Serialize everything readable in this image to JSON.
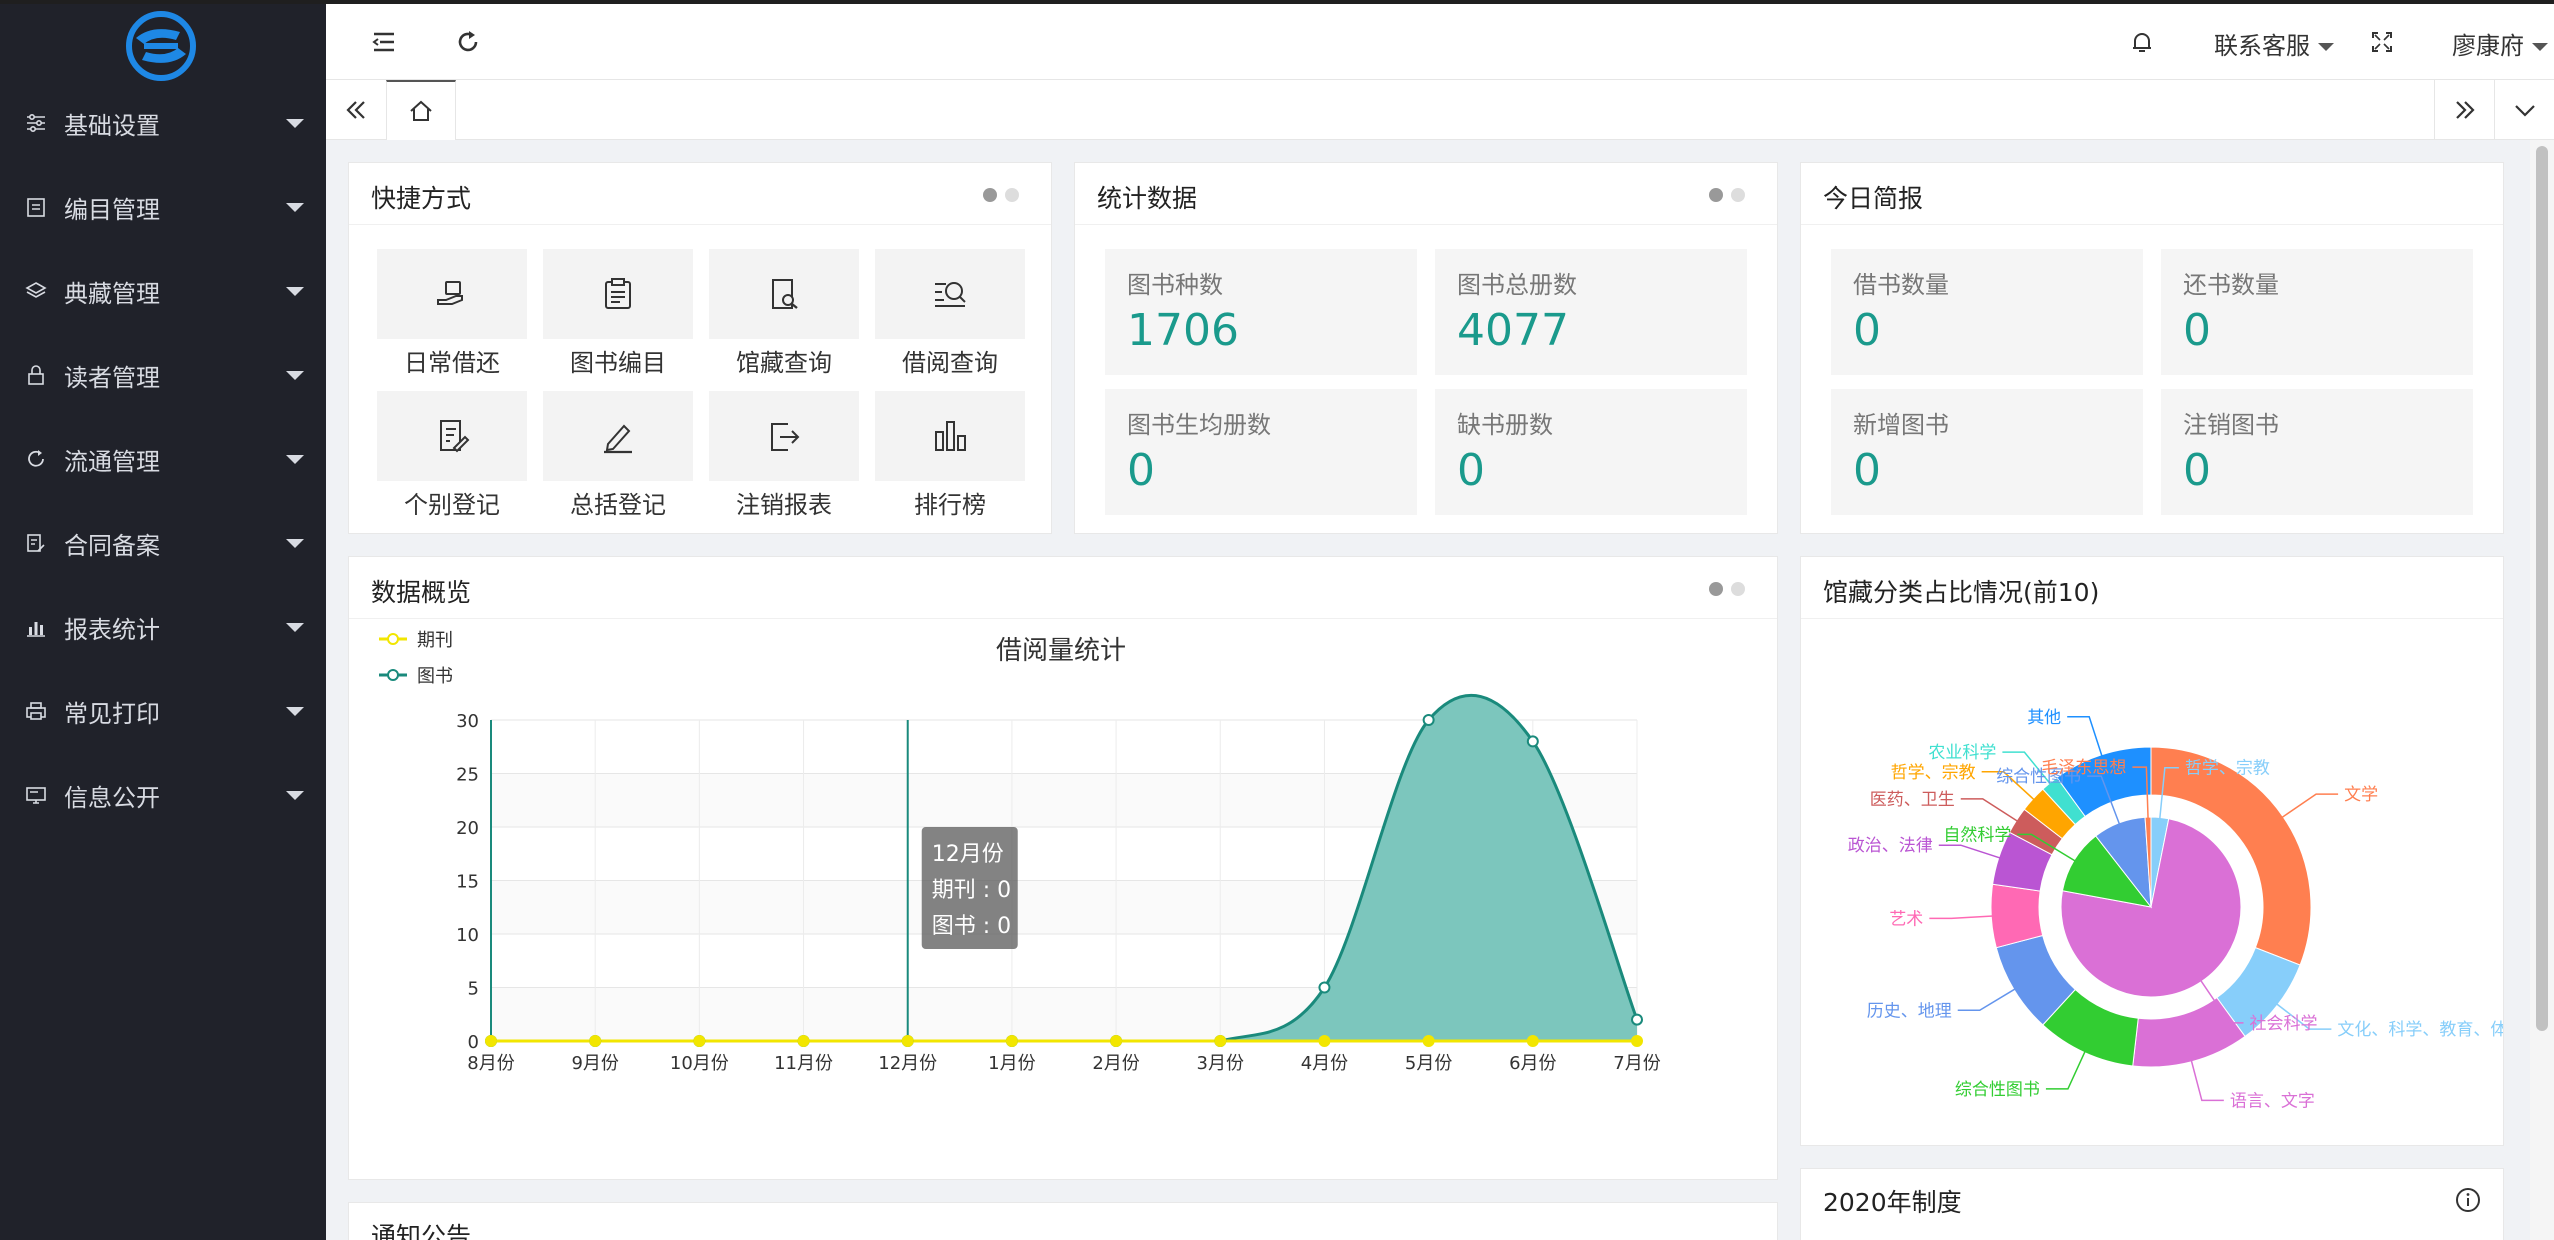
{
  "sidebar": {
    "items": [
      {
        "label": "基础设置",
        "icon": "sliders-icon"
      },
      {
        "label": "编目管理",
        "icon": "catalog-icon"
      },
      {
        "label": "典藏管理",
        "icon": "layers-icon"
      },
      {
        "label": "读者管理",
        "icon": "lock-icon"
      },
      {
        "label": "流通管理",
        "icon": "refresh-icon"
      },
      {
        "label": "合同备案",
        "icon": "contract-icon"
      },
      {
        "label": "报表统计",
        "icon": "bar-chart-icon"
      },
      {
        "label": "常见打印",
        "icon": "printer-icon"
      },
      {
        "label": "信息公开",
        "icon": "monitor-icon"
      }
    ]
  },
  "header": {
    "support_label": "联系客服",
    "user_name": "廖康府"
  },
  "quick": {
    "title": "快捷方式",
    "items": [
      {
        "label": "日常借还",
        "icon": "hand-book-icon"
      },
      {
        "label": "图书编目",
        "icon": "clipboard-icon"
      },
      {
        "label": "馆藏查询",
        "icon": "book-search-icon"
      },
      {
        "label": "借阅查询",
        "icon": "list-search-icon"
      },
      {
        "label": "个别登记",
        "icon": "doc-edit-icon"
      },
      {
        "label": "总括登记",
        "icon": "pen-icon"
      },
      {
        "label": "注销报表",
        "icon": "exit-icon"
      },
      {
        "label": "排行榜",
        "icon": "ranking-icon"
      }
    ]
  },
  "stats": {
    "title": "统计数据",
    "items": [
      {
        "label": "图书种数",
        "value": "1706"
      },
      {
        "label": "图书总册数",
        "value": "4077"
      },
      {
        "label": "图书生均册数",
        "value": "0"
      },
      {
        "label": "缺书册数",
        "value": "0"
      }
    ]
  },
  "today": {
    "title": "今日简报",
    "items": [
      {
        "label": "借书数量",
        "value": "0"
      },
      {
        "label": "还书数量",
        "value": "0"
      },
      {
        "label": "新增图书",
        "value": "0"
      },
      {
        "label": "注销图书",
        "value": "0"
      }
    ]
  },
  "overview": {
    "title": "数据概览"
  },
  "category": {
    "title": "馆藏分类占比情况(前10)"
  },
  "notice": {
    "title": "通知公告"
  },
  "policy": {
    "title": "2020年制度"
  },
  "tooltip": {
    "title": "12月份",
    "line1": "期刊 : 0",
    "line2": "图书 : 0"
  },
  "chart_data": [
    {
      "type": "area",
      "title": "借阅量统计",
      "categories": [
        "8月份",
        "9月份",
        "10月份",
        "11月份",
        "12月份",
        "1月份",
        "2月份",
        "3月份",
        "4月份",
        "5月份",
        "6月份",
        "7月份"
      ],
      "series": [
        {
          "name": "期刊",
          "values": [
            0,
            0,
            0,
            0,
            0,
            0,
            0,
            0,
            0,
            0,
            0,
            0
          ],
          "color": "#f2e600"
        },
        {
          "name": "图书",
          "values": [
            0,
            0,
            0,
            0,
            0,
            0,
            0,
            0,
            5,
            30,
            28,
            2
          ],
          "color": "#1a8a7c"
        }
      ],
      "yticks": [
        0,
        5,
        10,
        15,
        20,
        25,
        30
      ],
      "ylim": [
        0,
        30
      ],
      "legend": "top-left",
      "grid": true
    },
    {
      "type": "pie",
      "inner_ring": [
        {
          "name": "哲学、宗教",
          "value": 3,
          "color": "#87cefa"
        },
        {
          "name": "社会科学",
          "value": 71,
          "color": "#da70d6"
        },
        {
          "name": "自然科学",
          "value": 11,
          "color": "#32cd32"
        },
        {
          "name": "综合性图书",
          "value": 9,
          "color": "#6495ed"
        },
        {
          "name": "毛泽东思想",
          "value": 1,
          "color": "#ff7f50"
        }
      ],
      "outer_ring": [
        {
          "name": "文学",
          "value": 34,
          "color": "#ff7f50"
        },
        {
          "name": "文化、科学、教育、体育",
          "value": 10,
          "color": "#87cefa"
        },
        {
          "name": "语言、文字",
          "value": 13,
          "color": "#da70d6"
        },
        {
          "name": "综合性图书",
          "value": 11,
          "color": "#32cd32"
        },
        {
          "name": "历史、地理",
          "value": 10,
          "color": "#6495ed"
        },
        {
          "name": "艺术",
          "value": 7,
          "color": "#ff69b4"
        },
        {
          "name": "政治、法律",
          "value": 6,
          "color": "#ba55d3"
        },
        {
          "name": "医药、卫生",
          "value": 3,
          "color": "#cd5c5c"
        },
        {
          "name": "哲学、宗教",
          "value": 3,
          "color": "#ffa500"
        },
        {
          "name": "农业科学",
          "value": 2,
          "color": "#40e0d0"
        },
        {
          "name": "其他",
          "value": 11,
          "color": "#1e90ff"
        }
      ]
    }
  ]
}
